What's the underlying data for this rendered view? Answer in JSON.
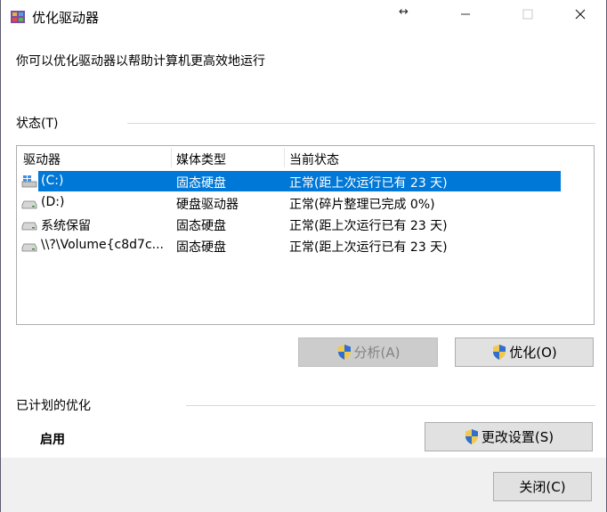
{
  "window": {
    "title": "优化驱动器",
    "intro": "你可以优化驱动器以帮助计算机更高效地运行"
  },
  "status_section": {
    "label": "状态(T)"
  },
  "drives_list": {
    "columns": [
      "驱动器",
      "媒体类型",
      "当前状态"
    ],
    "rows": [
      {
        "drive": "(C:)",
        "media": "固态硬盘",
        "status": "正常(距上次运行已有 23 天)",
        "icon": "windows-drive-icon",
        "selected": true
      },
      {
        "drive": "(D:)",
        "media": "硬盘驱动器",
        "status": "正常(碎片整理已完成 0%)",
        "icon": "drive-icon",
        "selected": false
      },
      {
        "drive": "系统保留",
        "media": "固态硬盘",
        "status": "正常(距上次运行已有 23 天)",
        "icon": "drive-icon",
        "selected": false
      },
      {
        "drive": "\\\\?\\Volume{c8d7c...",
        "media": "固态硬盘",
        "status": "正常(距上次运行已有 23 天)",
        "icon": "drive-icon",
        "selected": false
      }
    ]
  },
  "actions": {
    "analyze_label": "分析(A)",
    "optimize_label": "优化(O)"
  },
  "schedule_section": {
    "label": "已计划的优化",
    "state": "启用",
    "change_settings_label": "更改设置(S)"
  },
  "footer": {
    "close_label": "关闭(C)"
  },
  "colors": {
    "selection": "#0078d7",
    "button_bg": "#e1e1e1",
    "footer_bg": "#f0f0f0"
  }
}
